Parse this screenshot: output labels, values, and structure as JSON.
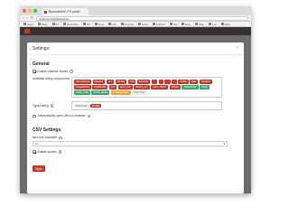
{
  "browser": {
    "tab_title": "Barcodeline: FS panel",
    "url": "localhost:3000/#/settings",
    "bookmarks": [
      "Apps",
      "Daily",
      "AT",
      "Barcodes",
      "FS",
      "Gear",
      "CA",
      "Chrome",
      "Docs",
      "Kitchen",
      "SQ",
      "Eng",
      "Help",
      "List",
      "Misc"
    ]
  },
  "modal": {
    "title": "Settings",
    "close": "×",
    "general": {
      "heading": "General",
      "enable_realtime": "Enable realtime stream",
      "components_label": "Available string components",
      "chips": [
        {
          "label": "BACKSPACE",
          "color": "red"
        },
        {
          "label": "DELETE",
          "color": "red"
        },
        {
          "label": "ALT",
          "color": "red"
        },
        {
          "label": "ENTER",
          "color": "red"
        },
        {
          "label": "TAB",
          "color": "red"
        },
        {
          "label": "ESCAPE",
          "color": "red"
        },
        {
          "label": "←",
          "color": "red"
        },
        {
          "label": "↑",
          "color": "red"
        },
        {
          "label": "→",
          "color": "red"
        },
        {
          "label": "↓",
          "color": "red"
        },
        {
          "label": "HOME",
          "color": "red"
        },
        {
          "label": "END",
          "color": "red"
        },
        {
          "label": "PAGEUP",
          "color": "red"
        },
        {
          "label": "PAGEDOWN",
          "color": "red"
        },
        {
          "label": "COMMAND",
          "color": "red"
        },
        {
          "label": "ALT",
          "color": "red"
        },
        {
          "label": "LEFT_ALT",
          "color": "red"
        },
        {
          "label": "RIGHT_ALT",
          "color": "red"
        },
        {
          "label": "LEFT_SHIFT",
          "color": "red"
        },
        {
          "label": "SPACE",
          "color": "red"
        },
        {
          "label": "TIMESTAMP",
          "color": "green"
        },
        {
          "label": "DATE",
          "color": "green"
        },
        {
          "label": "DATE_TIME",
          "color": "green"
        },
        {
          "label": "SCAN_INDEX",
          "color": "green"
        },
        {
          "label": "CUSTOM TEXT",
          "color": "orange"
        },
        {
          "label": "BARCODE",
          "color": "grey"
        }
      ],
      "typed_label": "Typed string",
      "typed_chips": [
        {
          "label": "BARCODE",
          "color": "grey"
        },
        {
          "label": "ENTER",
          "color": "red"
        }
      ],
      "auto_open": "Automatically open URLs in browser"
    },
    "csv": {
      "heading": "CSV Settings",
      "newline_label": "New line character",
      "newline_value": "LF",
      "enable_quotes": "Enable quotes"
    },
    "save": "Save"
  }
}
